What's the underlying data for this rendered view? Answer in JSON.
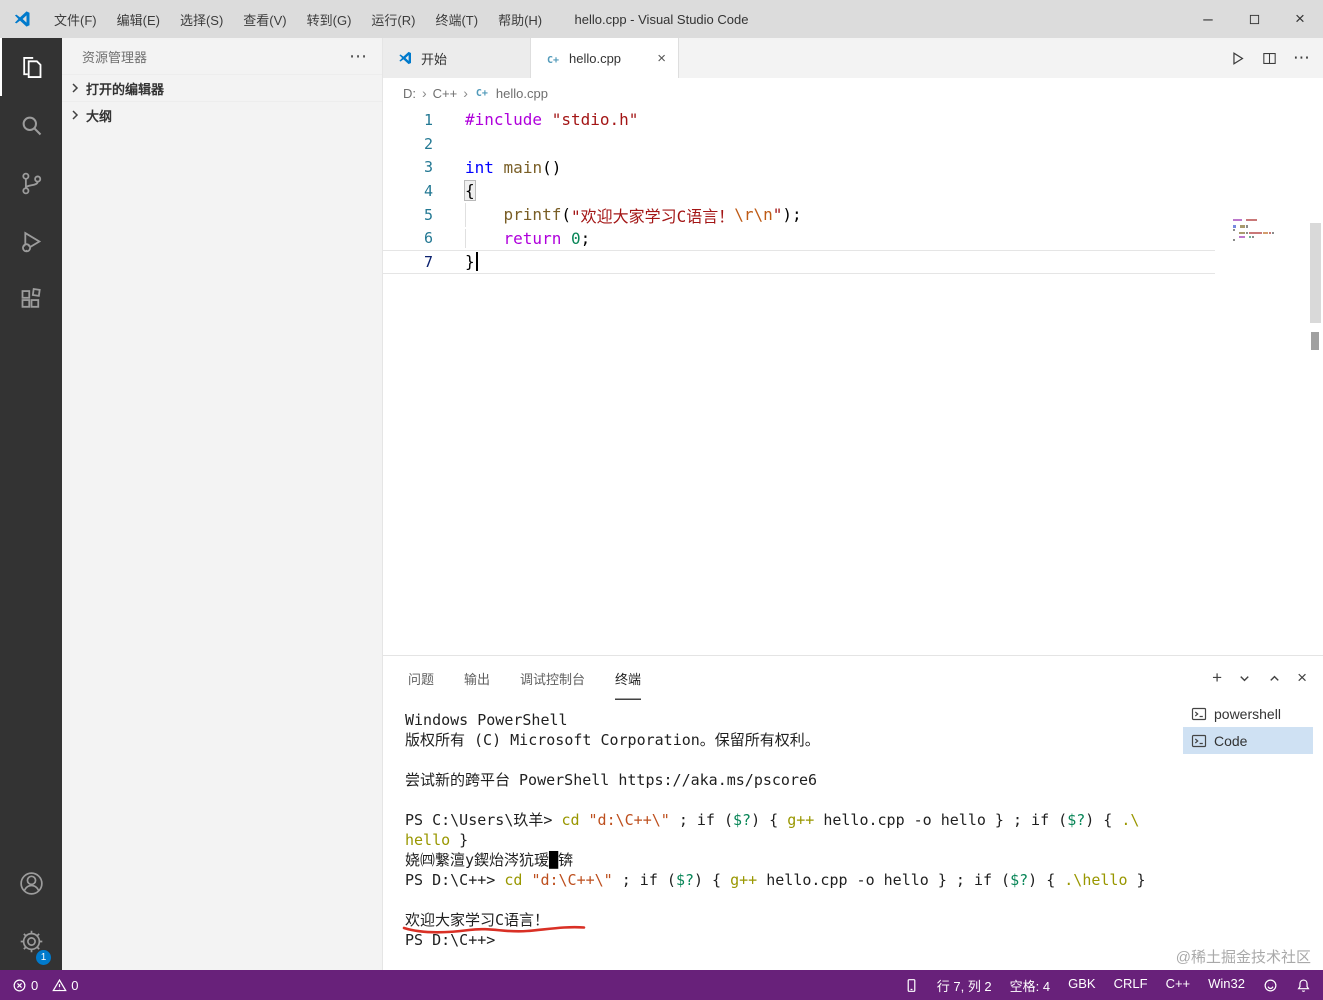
{
  "colors": {
    "accent": "#007acc",
    "statusbar": "#68217a",
    "annotation_red": "#d93025"
  },
  "icons": {
    "close": "×",
    "more": "⋯",
    "minimize": "–",
    "crumb_sep": "›",
    "plus": "+",
    "cpp_badge": "C+"
  },
  "title_bar": {
    "title": "hello.cpp - Visual Studio Code",
    "menus": [
      {
        "label": "文件(F)"
      },
      {
        "label": "编辑(E)"
      },
      {
        "label": "选择(S)"
      },
      {
        "label": "查看(V)"
      },
      {
        "label": "转到(G)"
      },
      {
        "label": "运行(R)"
      },
      {
        "label": "终端(T)"
      },
      {
        "label": "帮助(H)"
      }
    ]
  },
  "activity_bar": {
    "badge": "1"
  },
  "sidebar": {
    "title": "资源管理器",
    "sections": [
      {
        "label": "打开的编辑器"
      },
      {
        "label": "大纲"
      }
    ]
  },
  "editor": {
    "tabs": [
      {
        "label": "开始",
        "icon": "vscode",
        "active": false
      },
      {
        "label": "hello.cpp",
        "icon": "cpp",
        "active": true
      }
    ],
    "breadcrumbs": [
      {
        "label": "D:"
      },
      {
        "label": "C++"
      },
      {
        "label": "hello.cpp",
        "icon": "cpp"
      }
    ],
    "code_lines": [
      {
        "num": "1",
        "segments": [
          {
            "text": "#include",
            "cls": "tk-pre"
          },
          {
            "text": " "
          },
          {
            "text": "\"stdio.h\"",
            "cls": "tk-str"
          }
        ]
      },
      {
        "num": "2",
        "segments": []
      },
      {
        "num": "3",
        "segments": [
          {
            "text": "int",
            "cls": "tk-kw"
          },
          {
            "text": " "
          },
          {
            "text": "main",
            "cls": "tk-fn"
          },
          {
            "text": "()"
          }
        ]
      },
      {
        "num": "4",
        "segments": [
          {
            "text": "{",
            "cls": "tk-bracket"
          }
        ]
      },
      {
        "num": "5",
        "guide": true,
        "segments": [
          {
            "text": "    "
          },
          {
            "text": "printf",
            "cls": "tk-fn"
          },
          {
            "text": "("
          },
          {
            "text": "\"欢迎大家学习C语言！",
            "cls": "tk-str"
          },
          {
            "text": "\\r\\n",
            "cls": "tk-esc"
          },
          {
            "text": "\"",
            "cls": "tk-str"
          },
          {
            "text": ");"
          }
        ]
      },
      {
        "num": "6",
        "guide": true,
        "segments": [
          {
            "text": "    "
          },
          {
            "text": "return",
            "cls": "tk-kw2"
          },
          {
            "text": " "
          },
          {
            "text": "0",
            "cls": "tk-num"
          },
          {
            "text": ";"
          }
        ]
      },
      {
        "num": "7",
        "current": true,
        "cursor": true,
        "segments": [
          {
            "text": "}"
          }
        ]
      }
    ]
  },
  "panel": {
    "tabs": [
      {
        "label": "问题"
      },
      {
        "label": "输出"
      },
      {
        "label": "调试控制台"
      },
      {
        "label": "终端",
        "active": true
      }
    ],
    "terminal": {
      "lines": [
        {
          "segments": [
            {
              "text": "Windows PowerShell"
            }
          ]
        },
        {
          "segments": [
            {
              "text": "版权所有 (C) Microsoft Corporation。保留所有权利。"
            }
          ]
        },
        {
          "segments": []
        },
        {
          "segments": [
            {
              "text": "尝试新的跨平台 PowerShell https://aka.ms/pscore6"
            }
          ]
        },
        {
          "segments": []
        },
        {
          "segments": [
            {
              "text": "PS C:\\Users\\玖羊> "
            },
            {
              "text": "cd",
              "cls": "t-cmd"
            },
            {
              "text": " "
            },
            {
              "text": "\"d:\\C++\\\"",
              "cls": "t-str"
            },
            {
              "text": " ; if ("
            },
            {
              "text": "$?",
              "cls": "t-var"
            },
            {
              "text": ") { "
            },
            {
              "text": "g++",
              "cls": "t-cmd"
            },
            {
              "text": " hello.cpp -o hello } ; if ("
            },
            {
              "text": "$?",
              "cls": "t-var"
            },
            {
              "text": ") { "
            },
            {
              "text": ".\\",
              "cls": "t-cmd"
            }
          ]
        },
        {
          "segments": [
            {
              "text": "hello",
              "cls": "t-cmd"
            },
            {
              "text": " }"
            }
          ]
        },
        {
          "segments": [
            {
              "text": "娆㈣繋澶у鍥炲涔犺瑷"
            },
            {
              "text": "█",
              "cls": "t-block"
            },
            {
              "text": "锛"
            }
          ]
        },
        {
          "segments": [
            {
              "text": "PS D:\\C++> "
            },
            {
              "text": "cd",
              "cls": "t-cmd"
            },
            {
              "text": " "
            },
            {
              "text": "\"d:\\C++\\\"",
              "cls": "t-str"
            },
            {
              "text": " ; if ("
            },
            {
              "text": "$?",
              "cls": "t-var"
            },
            {
              "text": ") { "
            },
            {
              "text": "g++",
              "cls": "t-cmd"
            },
            {
              "text": " hello.cpp -o hello } ; if ("
            },
            {
              "text": "$?",
              "cls": "t-var"
            },
            {
              "text": ") { "
            },
            {
              "text": ".\\hello",
              "cls": "t-cmd"
            },
            {
              "text": " }"
            }
          ]
        },
        {
          "segments": []
        },
        {
          "annotated": true,
          "segments": [
            {
              "text": "欢迎大家学习C语言！"
            }
          ]
        },
        {
          "segments": [
            {
              "text": "PS D:\\C++>"
            }
          ]
        }
      ],
      "list": [
        {
          "label": "powershell",
          "selected": false
        },
        {
          "label": "Code",
          "selected": true
        }
      ]
    }
  },
  "status_bar": {
    "errors": "0",
    "warnings": "0",
    "items": [
      {
        "name": "cursor-position",
        "label": "行 7, 列 2"
      },
      {
        "name": "indentation",
        "label": "空格: 4"
      },
      {
        "name": "encoding",
        "label": "GBK"
      },
      {
        "name": "eol",
        "label": "CRLF"
      },
      {
        "name": "language",
        "label": "C++"
      },
      {
        "name": "platform",
        "label": "Win32"
      }
    ]
  },
  "watermark": "@稀土掘金技术社区"
}
